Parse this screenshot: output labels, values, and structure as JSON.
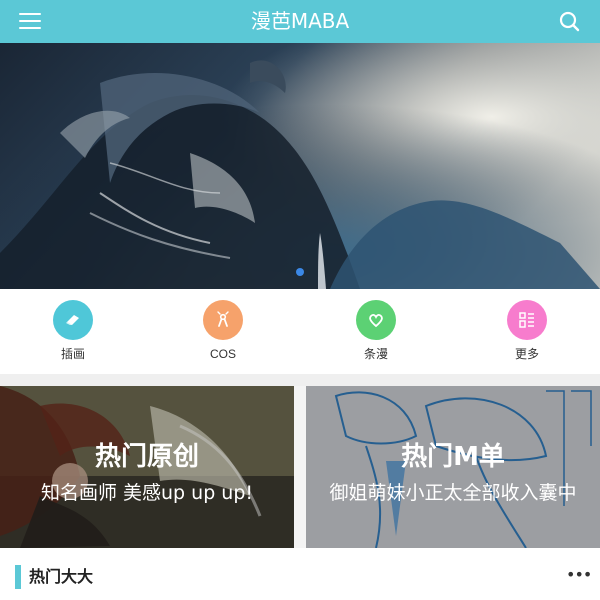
{
  "header": {
    "title": "漫芭MABA",
    "menu_icon": "hamburger-menu-icon",
    "search_icon": "search-icon",
    "background": "#5bc8d6"
  },
  "banner": {
    "image": "dragon-artwork",
    "dot_count": 1,
    "active_dot": 0,
    "dot_color": "#3b88e6"
  },
  "quicknav": {
    "items": [
      {
        "label": "插画",
        "icon": "eraser-icon",
        "color": "#4fc7d8"
      },
      {
        "label": "COS",
        "icon": "bow-icon",
        "color": "#f6a26b"
      },
      {
        "label": "条漫",
        "icon": "heart-icon",
        "color": "#5cd174"
      },
      {
        "label": "更多",
        "icon": "grid-list-icon",
        "color": "#f77ccd"
      }
    ]
  },
  "cards": [
    {
      "title": "热门原创",
      "subtitle": "知名画师 美感up up up!"
    },
    {
      "title": "热门M单",
      "subtitle": "御姐萌妹小正太全部收入囊中"
    }
  ],
  "section": {
    "title": "热门大大",
    "more_label": "•••",
    "accent": "#5bc8d6"
  }
}
